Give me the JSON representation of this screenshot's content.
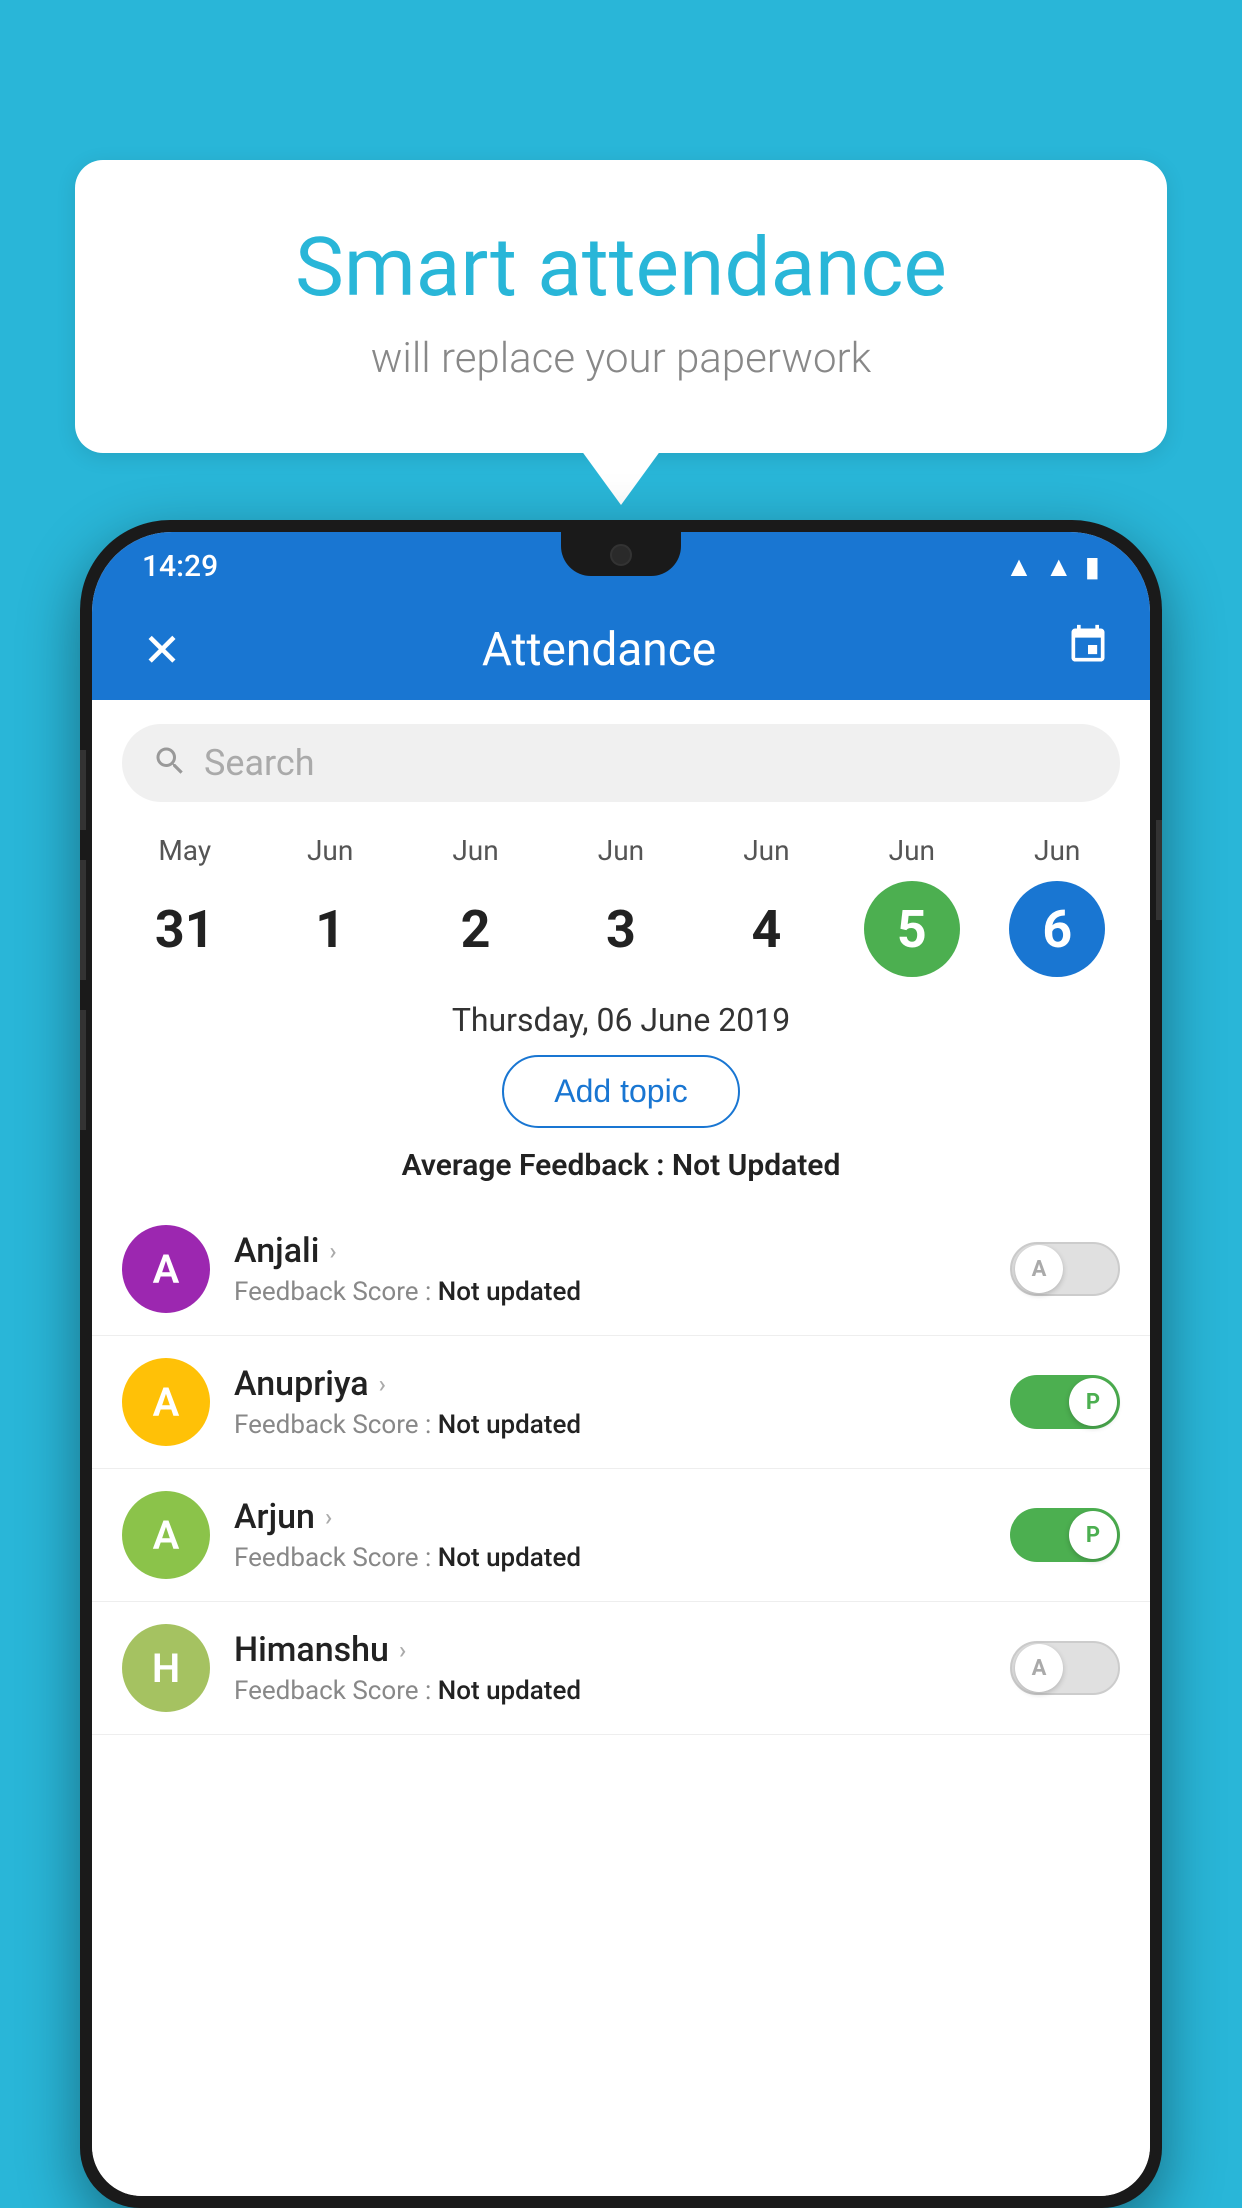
{
  "background_color": "#29b6d8",
  "bubble": {
    "title": "Smart attendance",
    "subtitle": "will replace your paperwork"
  },
  "status_bar": {
    "time": "14:29",
    "wifi": "▲",
    "signal": "▲",
    "battery": "▮"
  },
  "app_bar": {
    "close_label": "✕",
    "title": "Attendance",
    "calendar_label": "📅"
  },
  "search": {
    "placeholder": "Search"
  },
  "calendar": {
    "days": [
      {
        "month": "May",
        "date": "31",
        "style": "normal"
      },
      {
        "month": "Jun",
        "date": "1",
        "style": "normal"
      },
      {
        "month": "Jun",
        "date": "2",
        "style": "normal"
      },
      {
        "month": "Jun",
        "date": "3",
        "style": "normal"
      },
      {
        "month": "Jun",
        "date": "4",
        "style": "normal"
      },
      {
        "month": "Jun",
        "date": "5",
        "style": "today"
      },
      {
        "month": "Jun",
        "date": "6",
        "style": "selected"
      }
    ]
  },
  "selected_date_label": "Thursday, 06 June 2019",
  "add_topic_label": "Add topic",
  "avg_feedback": {
    "label": "Average Feedback : ",
    "value": "Not Updated"
  },
  "students": [
    {
      "name": "Anjali",
      "avatar_letter": "A",
      "avatar_color": "#9c27b0",
      "feedback": "Feedback Score : ",
      "feedback_value": "Not updated",
      "toggle": "off",
      "toggle_letter": "A"
    },
    {
      "name": "Anupriya",
      "avatar_letter": "A",
      "avatar_color": "#ffc107",
      "feedback": "Feedback Score : ",
      "feedback_value": "Not updated",
      "toggle": "on",
      "toggle_letter": "P"
    },
    {
      "name": "Arjun",
      "avatar_letter": "A",
      "avatar_color": "#8bc34a",
      "feedback": "Feedback Score : ",
      "feedback_value": "Not updated",
      "toggle": "on",
      "toggle_letter": "P"
    },
    {
      "name": "Himanshu",
      "avatar_letter": "H",
      "avatar_color": "#a5c261",
      "feedback": "Feedback Score : ",
      "feedback_value": "Not updated",
      "toggle": "off",
      "toggle_letter": "A"
    }
  ]
}
